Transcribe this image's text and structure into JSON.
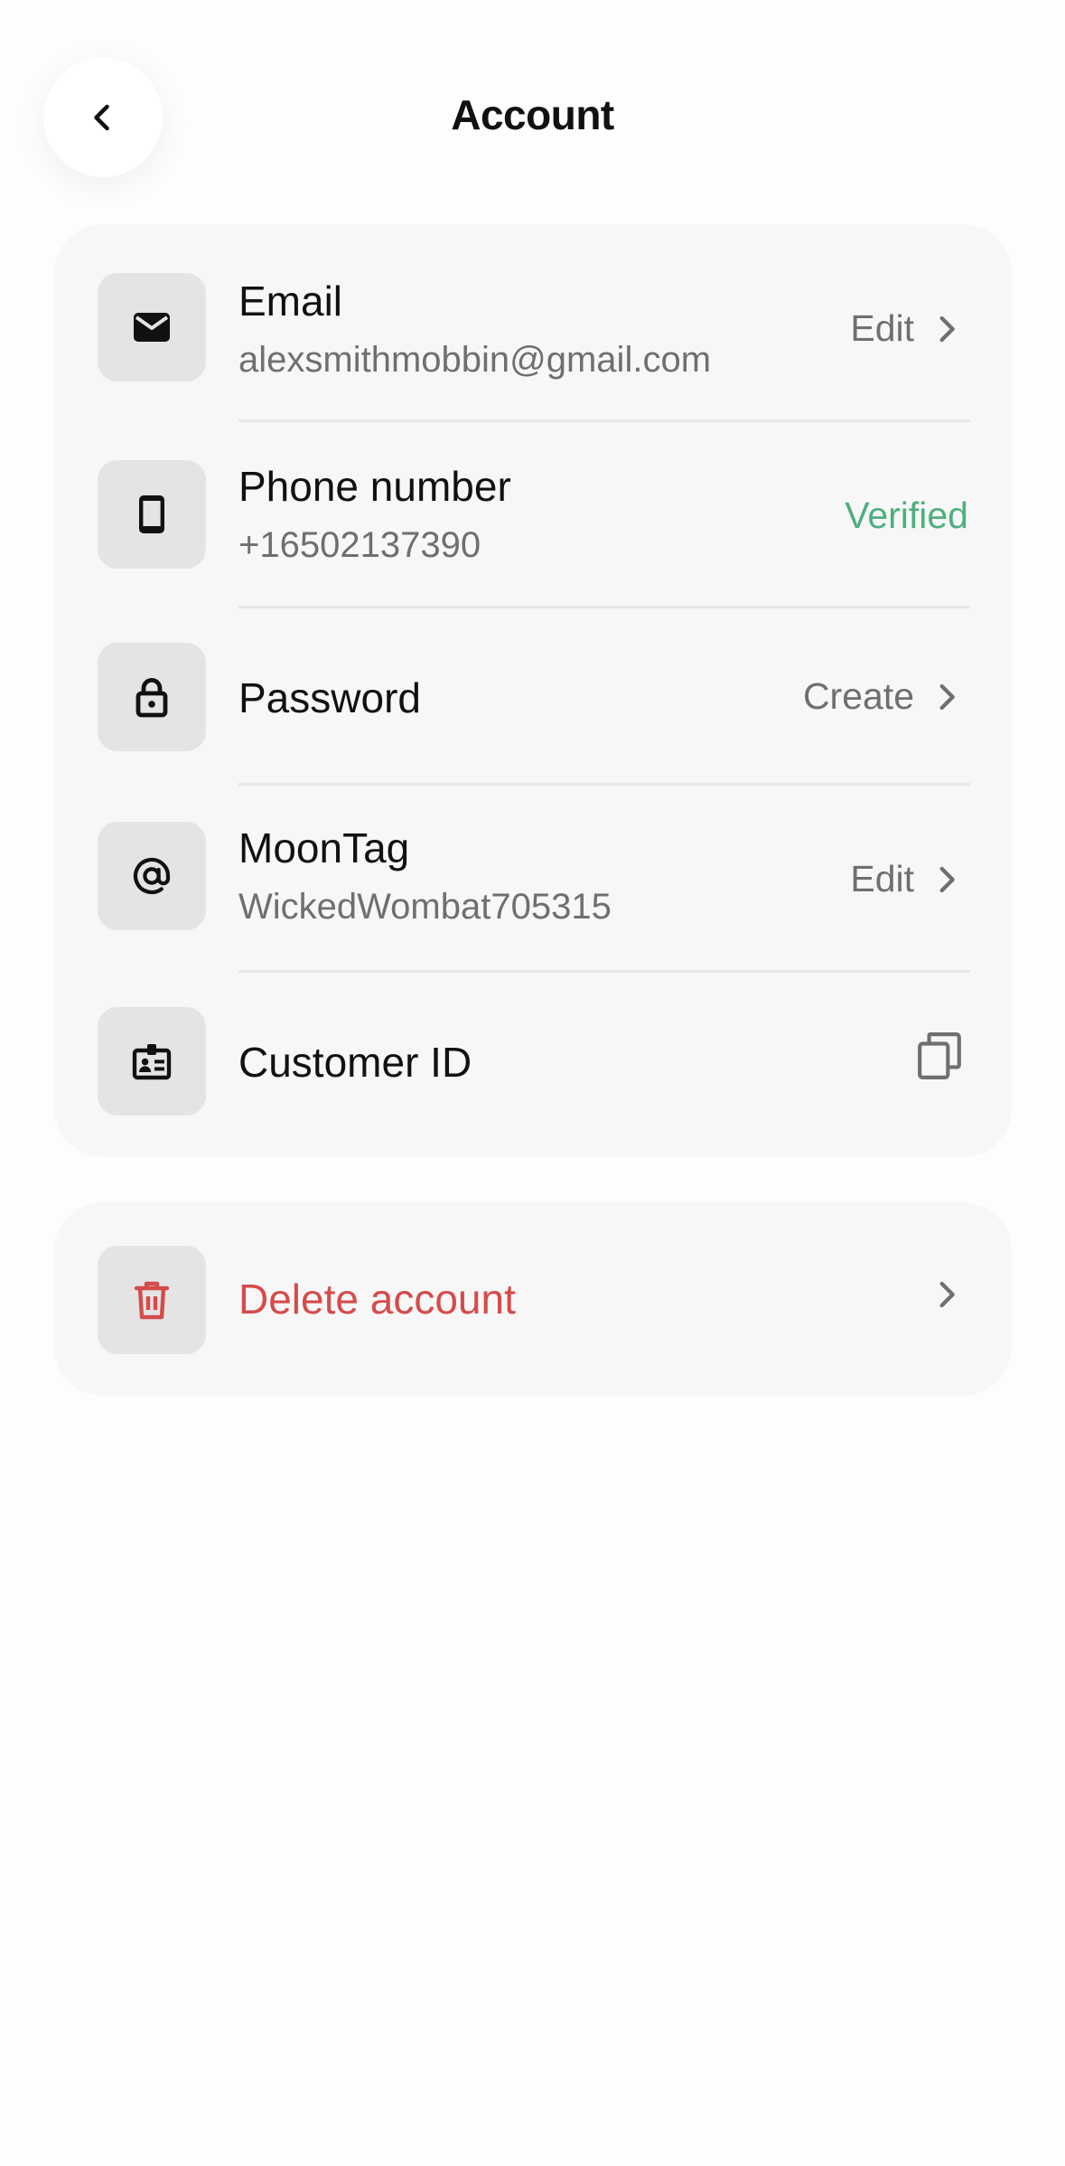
{
  "header": {
    "title": "Account",
    "back_icon": "chevron-left-icon"
  },
  "account_rows": {
    "email": {
      "icon": "mail-icon",
      "title": "Email",
      "value": "alexsmithmobbin@gmail.com",
      "action": "Edit"
    },
    "phone": {
      "icon": "phone-icon",
      "title": "Phone number",
      "value": "+16502137390",
      "status": "Verified"
    },
    "password": {
      "icon": "lock-icon",
      "title": "Password",
      "action": "Create"
    },
    "moontag": {
      "icon": "at-sign-icon",
      "title": "MoonTag",
      "value": "WickedWombat705315",
      "action": "Edit"
    },
    "customer_id": {
      "icon": "id-badge-icon",
      "title": "Customer ID",
      "action_icon": "copy-icon"
    }
  },
  "danger_zone": {
    "delete": {
      "icon": "trash-icon",
      "title": "Delete account"
    }
  },
  "colors": {
    "background": "#fdfdfd",
    "card": "#f7f7f7",
    "icon_tile": "#e4e4e4",
    "verified": "#4fae7f",
    "danger": "#d54b4b",
    "secondary_text": "#6f6f6f"
  }
}
